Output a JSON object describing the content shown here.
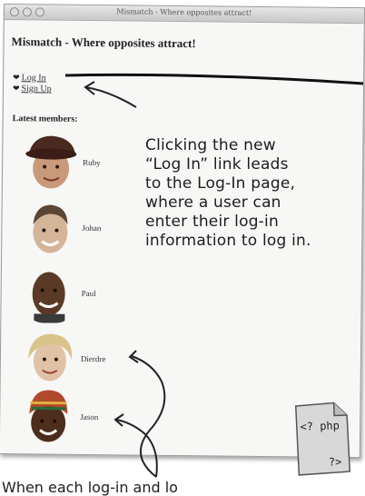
{
  "window": {
    "title": "Mismatch - Where opposites attract!"
  },
  "page": {
    "heading": "Mismatch - Where opposites attract!",
    "nav": [
      {
        "label": "Log In"
      },
      {
        "label": "Sign Up"
      }
    ],
    "latest_label": "Latest members:",
    "members": [
      {
        "name": "Ruby"
      },
      {
        "name": "Johan"
      },
      {
        "name": "Paul"
      },
      {
        "name": "Dierdre"
      },
      {
        "name": "Jason"
      }
    ]
  },
  "annotation": {
    "lines": [
      "Clicking the new",
      "“Log In” link leads",
      "to the Log-In page,",
      "where a user can",
      "enter their log-in",
      "information to log in."
    ],
    "bottom_note": "When each log-in and lo"
  },
  "php_file": {
    "open_tag": "<? php",
    "close_tag": "?>"
  },
  "icons": {
    "nav_bullet": "heart-icon"
  }
}
